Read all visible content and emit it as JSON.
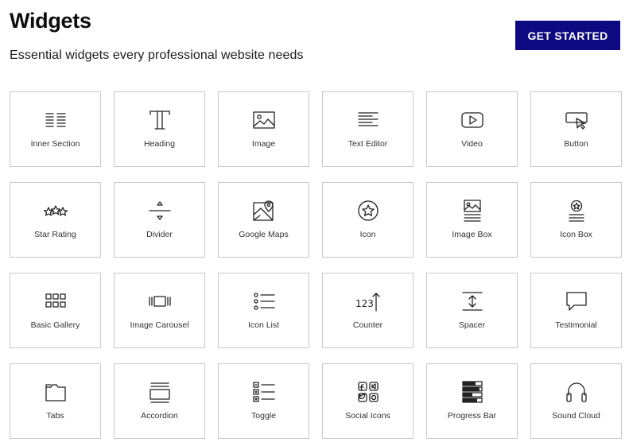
{
  "header": {
    "title": "Widgets",
    "subtitle": "Essential widgets every professional website needs",
    "cta_label": "GET STARTED"
  },
  "colors": {
    "cta_background": "#0d0980",
    "tile_border": "#c9c9c9"
  },
  "widgets": [
    {
      "label": "Inner Section",
      "icon": "inner-section-icon"
    },
    {
      "label": "Heading",
      "icon": "heading-icon"
    },
    {
      "label": "Image",
      "icon": "image-icon"
    },
    {
      "label": "Text Editor",
      "icon": "text-editor-icon"
    },
    {
      "label": "Video",
      "icon": "video-icon"
    },
    {
      "label": "Button",
      "icon": "button-icon"
    },
    {
      "label": "Star Rating",
      "icon": "star-rating-icon"
    },
    {
      "label": "Divider",
      "icon": "divider-icon"
    },
    {
      "label": "Google Maps",
      "icon": "google-maps-icon"
    },
    {
      "label": "Icon",
      "icon": "icon-icon"
    },
    {
      "label": "Image Box",
      "icon": "image-box-icon"
    },
    {
      "label": "Icon Box",
      "icon": "icon-box-icon"
    },
    {
      "label": "Basic Gallery",
      "icon": "basic-gallery-icon"
    },
    {
      "label": "Image Carousel",
      "icon": "image-carousel-icon"
    },
    {
      "label": "Icon List",
      "icon": "icon-list-icon"
    },
    {
      "label": "Counter",
      "icon": "counter-icon"
    },
    {
      "label": "Spacer",
      "icon": "spacer-icon"
    },
    {
      "label": "Testimonial",
      "icon": "testimonial-icon"
    },
    {
      "label": "Tabs",
      "icon": "tabs-icon"
    },
    {
      "label": "Accordion",
      "icon": "accordion-icon"
    },
    {
      "label": "Toggle",
      "icon": "toggle-icon"
    },
    {
      "label": "Social Icons",
      "icon": "social-icons-icon"
    },
    {
      "label": "Progress Bar",
      "icon": "progress-bar-icon"
    },
    {
      "label": "Sound Cloud",
      "icon": "sound-cloud-icon"
    }
  ]
}
